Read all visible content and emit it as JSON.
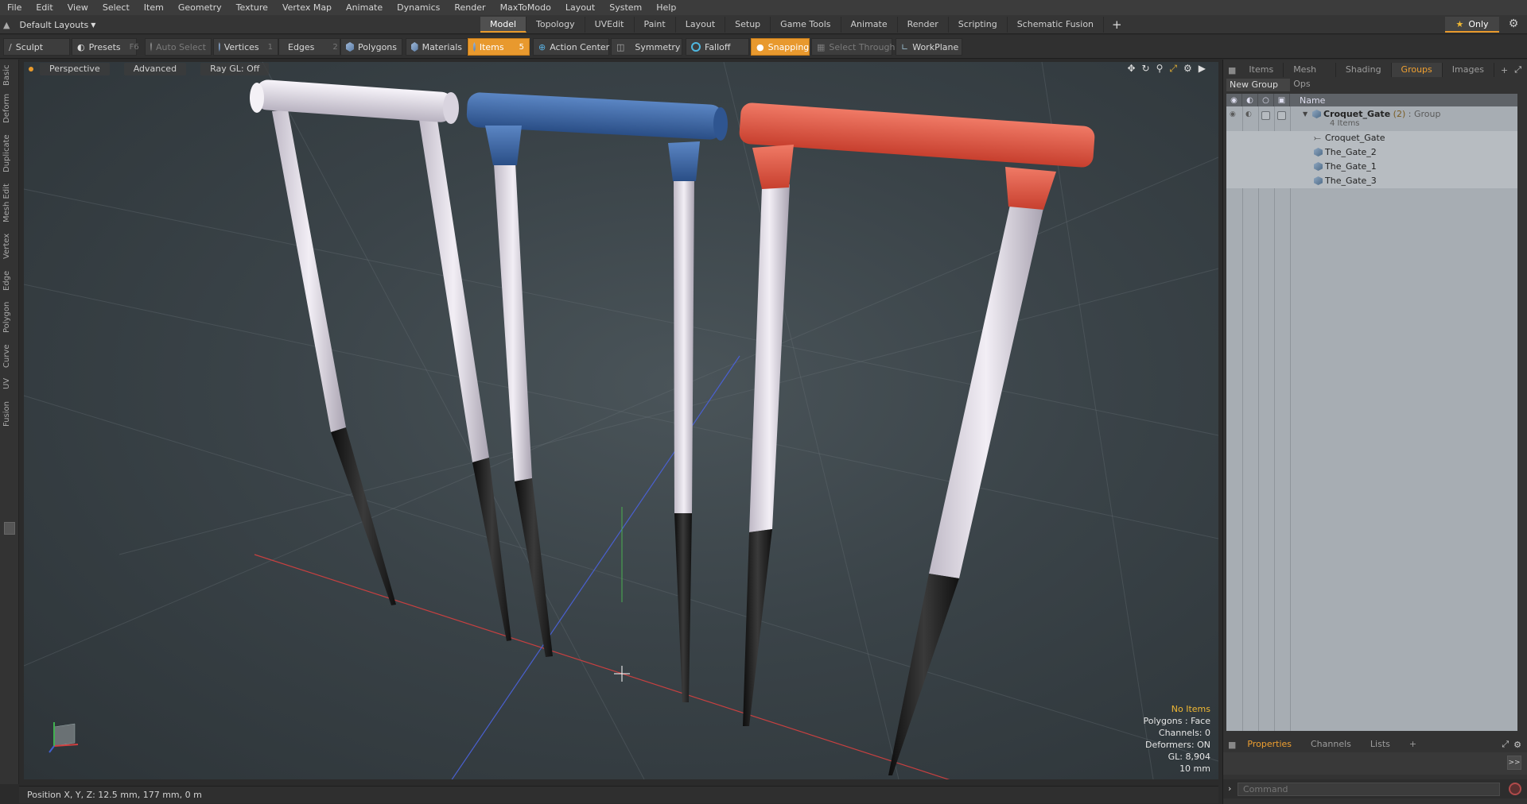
{
  "menu": [
    "File",
    "Edit",
    "View",
    "Select",
    "Item",
    "Geometry",
    "Texture",
    "Vertex Map",
    "Animate",
    "Dynamics",
    "Render",
    "MaxToModo",
    "Layout",
    "System",
    "Help"
  ],
  "layout": {
    "selector": "Default Layouts",
    "tabs": [
      "Model",
      "Topology",
      "UVEdit",
      "Paint",
      "Layout",
      "Setup",
      "Game Tools",
      "Animate",
      "Render",
      "Scripting",
      "Schematic Fusion"
    ],
    "active_tab": "Model",
    "add_tab": "+",
    "only_label": "Only",
    "accent": "#e89a2c"
  },
  "toolbar": {
    "sculpt": "Sculpt",
    "presets": "Presets",
    "presets_key": "F6",
    "auto_select": "Auto Select",
    "vertices": "Vertices",
    "vertices_key": "1",
    "edges": "Edges",
    "edges_key": "2",
    "polygons": "Polygons",
    "materials": "Materials",
    "items": "Items",
    "items_key": "5",
    "action_center": "Action Center",
    "symmetry": "Symmetry",
    "falloff": "Falloff",
    "snapping": "Snapping",
    "select_through": "Select Through",
    "workplane": "WorkPlane"
  },
  "left_tabs": [
    "Basic",
    "Deform",
    "Duplicate",
    "Mesh Edit",
    "Vertex",
    "Edge",
    "Polygon",
    "Curve",
    "UV",
    "Fusion"
  ],
  "viewport": {
    "view": "Perspective",
    "shading": "Advanced",
    "raygl": "Ray GL: Off",
    "info": {
      "selection": "No Items",
      "polygons": "Polygons : Face",
      "channels": "Channels: 0",
      "deformers": "Deformers: ON",
      "gl": "GL: 8,904",
      "scale": "10 mm"
    },
    "gate_colors": {
      "white": "#e8e4ec",
      "blue": "#3a64a3",
      "red": "#e0533f",
      "spike": "#1c1c1c"
    }
  },
  "status": {
    "position": "Position X, Y, Z:  12.5 mm, 177 mm, 0 m"
  },
  "right_panel": {
    "tabs": [
      "Items",
      "Mesh Ops",
      "Shading",
      "Groups",
      "Images"
    ],
    "active_tab": "Groups",
    "add": "+",
    "new_group": "New Group",
    "column_name": "Name",
    "group": {
      "name": "Croquet_Gate",
      "count": "(2)",
      "type": ": Group",
      "items_label": "4 Items"
    },
    "children": [
      "Croquet_Gate",
      "The_Gate_2",
      "The_Gate_1",
      "The_Gate_3"
    ],
    "bottom_tabs": [
      "Properties",
      "Channels",
      "Lists"
    ],
    "bottom_active": "Properties",
    "expand": ">>",
    "command_placeholder": "Command"
  }
}
